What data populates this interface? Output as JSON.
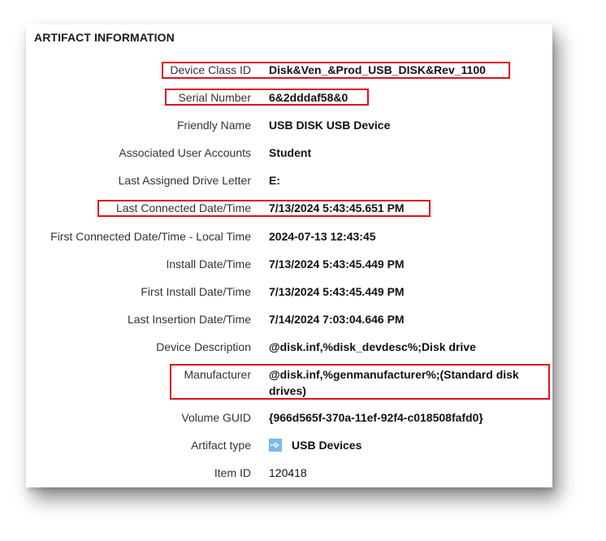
{
  "section": {
    "title": "ARTIFACT INFORMATION"
  },
  "rows": [
    {
      "label": "Device Class ID",
      "value": "Disk&Ven_&Prod_USB_DISK&Rev_1100",
      "highlighted": true
    },
    {
      "label": "Serial Number",
      "value": "6&2dddaf58&0",
      "highlighted": true
    },
    {
      "label": "Friendly Name",
      "value": "USB DISK USB Device",
      "highlighted": false
    },
    {
      "label": "Associated User Accounts",
      "value": "Student",
      "highlighted": false
    },
    {
      "label": "Last Assigned Drive Letter",
      "value": "E:",
      "highlighted": false
    },
    {
      "label": "Last Connected Date/Time",
      "value": "7/13/2024 5:43:45.651 PM",
      "highlighted": true
    },
    {
      "label": "First Connected Date/Time - Local Time",
      "value": "2024-07-13 12:43:45",
      "highlighted": false
    },
    {
      "label": "Install Date/Time",
      "value": "7/13/2024 5:43:45.449 PM",
      "highlighted": false
    },
    {
      "label": "First Install Date/Time",
      "value": "7/13/2024 5:43:45.449 PM",
      "highlighted": false
    },
    {
      "label": "Last Insertion Date/Time",
      "value": "7/14/2024 7:03:04.646 PM",
      "highlighted": false
    },
    {
      "label": "Device Description",
      "value": "@disk.inf,%disk_devdesc%;Disk drive",
      "highlighted": false
    },
    {
      "label": "Manufacturer",
      "value": "@disk.inf,%genmanufacturer%;(Standard disk drives)",
      "highlighted": true
    },
    {
      "label": "Volume GUID",
      "value": "{966d565f-370a-11ef-92f4-c018508fafd0}",
      "highlighted": false
    },
    {
      "label": "Artifact type",
      "value": "USB Devices",
      "icon": "usb-icon",
      "highlighted": false
    },
    {
      "label": "Item ID",
      "value": "120418",
      "highlighted": false
    }
  ],
  "colors": {
    "highlight": "#e0101b",
    "usb_icon": "#7ab8ea"
  }
}
